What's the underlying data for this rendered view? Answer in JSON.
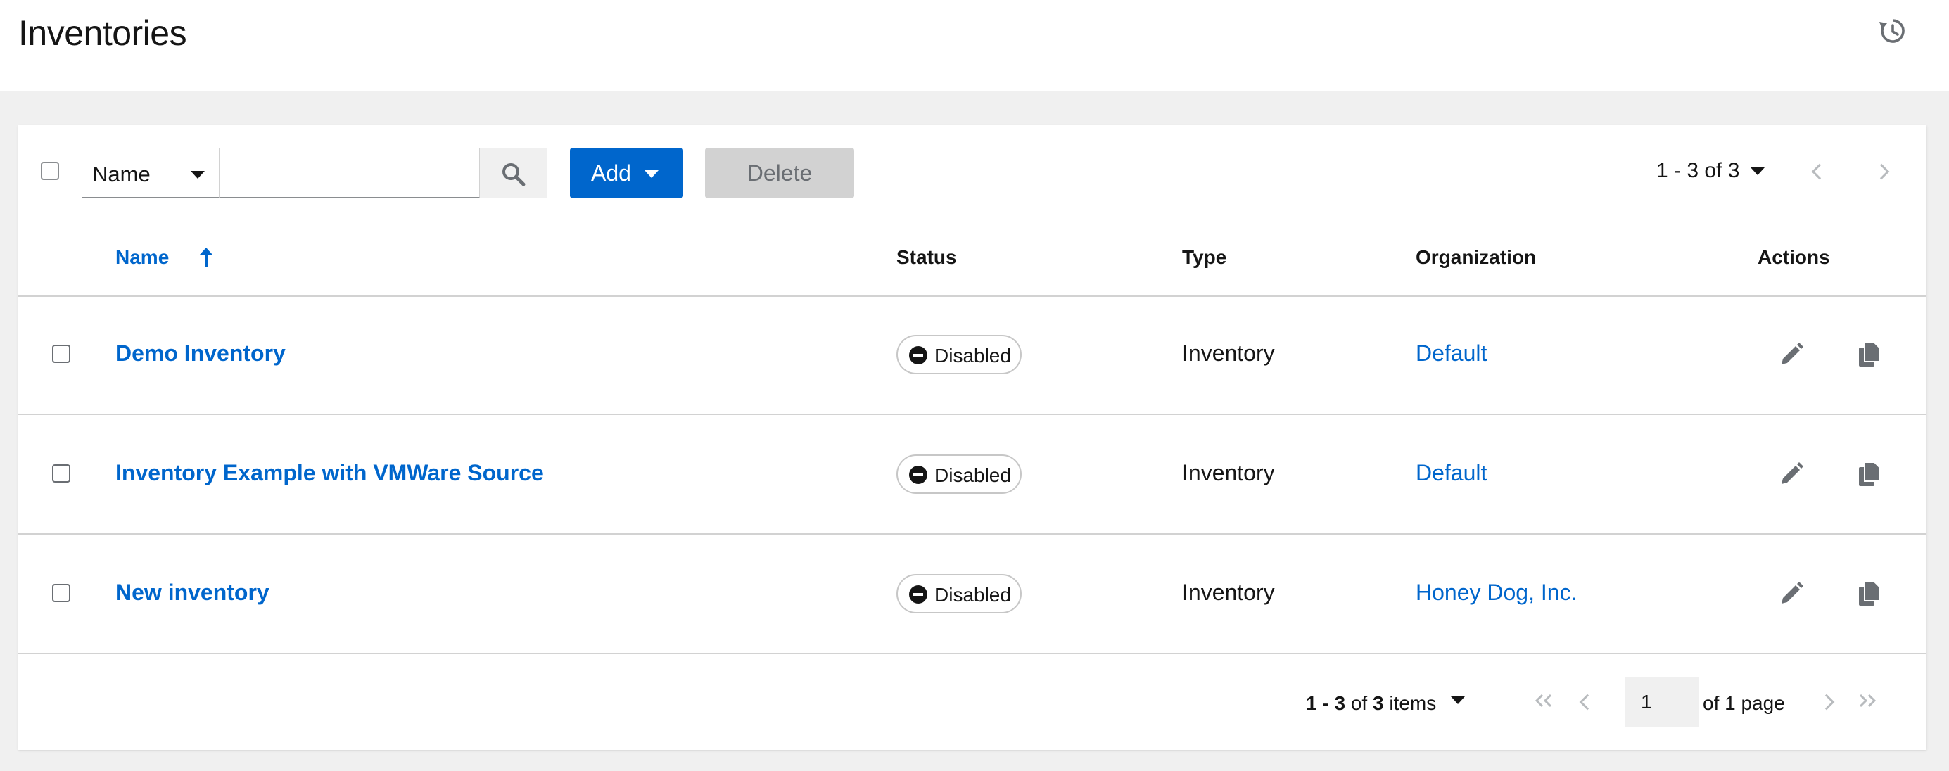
{
  "header": {
    "title": "Inventories",
    "history_icon": "history-icon"
  },
  "toolbar": {
    "filter_select_value": "Name",
    "search_placeholder": "",
    "add_label": "Add",
    "delete_label": "Delete",
    "pagination_range": "1 - 3 of 3"
  },
  "table": {
    "columns": [
      "Name",
      "Status",
      "Type",
      "Organization",
      "Actions"
    ],
    "sort": "ascending",
    "rows": [
      {
        "name": "Demo Inventory",
        "status": "Disabled",
        "type": "Inventory",
        "organization": "Default"
      },
      {
        "name": "Inventory Example with VMWare Source",
        "status": "Disabled",
        "type": "Inventory",
        "organization": "Default"
      },
      {
        "name": "New inventory",
        "status": "Disabled",
        "type": "Inventory",
        "organization": "Honey Dog, Inc."
      }
    ]
  },
  "footer": {
    "range_bold": "1 - 3",
    "range_of": "of",
    "range_total": "3",
    "range_suffix": "items",
    "page_value": "1",
    "page_of_text": "of 1 page"
  },
  "colors": {
    "link": "#0066cc",
    "primary_button": "#0066cc",
    "disabled_button": "#d2d2d2",
    "page_background": "#f0f0f0"
  }
}
